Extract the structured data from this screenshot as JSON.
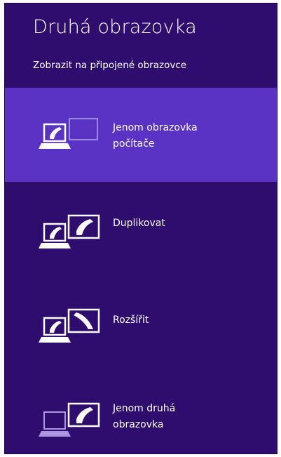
{
  "panel": {
    "title": "Druhá obrazovka",
    "subtitle": "Zobrazit na připojené obrazovce"
  },
  "options": [
    {
      "label": "Jenom obrazovka\npočítače",
      "icon": "pc-screen-only-icon",
      "selected": true
    },
    {
      "label": "Duplikovat",
      "icon": "duplicate-icon",
      "selected": false
    },
    {
      "label": "Rozšířit",
      "icon": "extend-icon",
      "selected": false
    },
    {
      "label": "Jenom druhá\nobrazovka",
      "icon": "second-screen-only-icon",
      "selected": false
    }
  ],
  "colors": {
    "background": "#2e0d6e",
    "selected": "#5a32c4",
    "foreground": "#ffffff"
  }
}
